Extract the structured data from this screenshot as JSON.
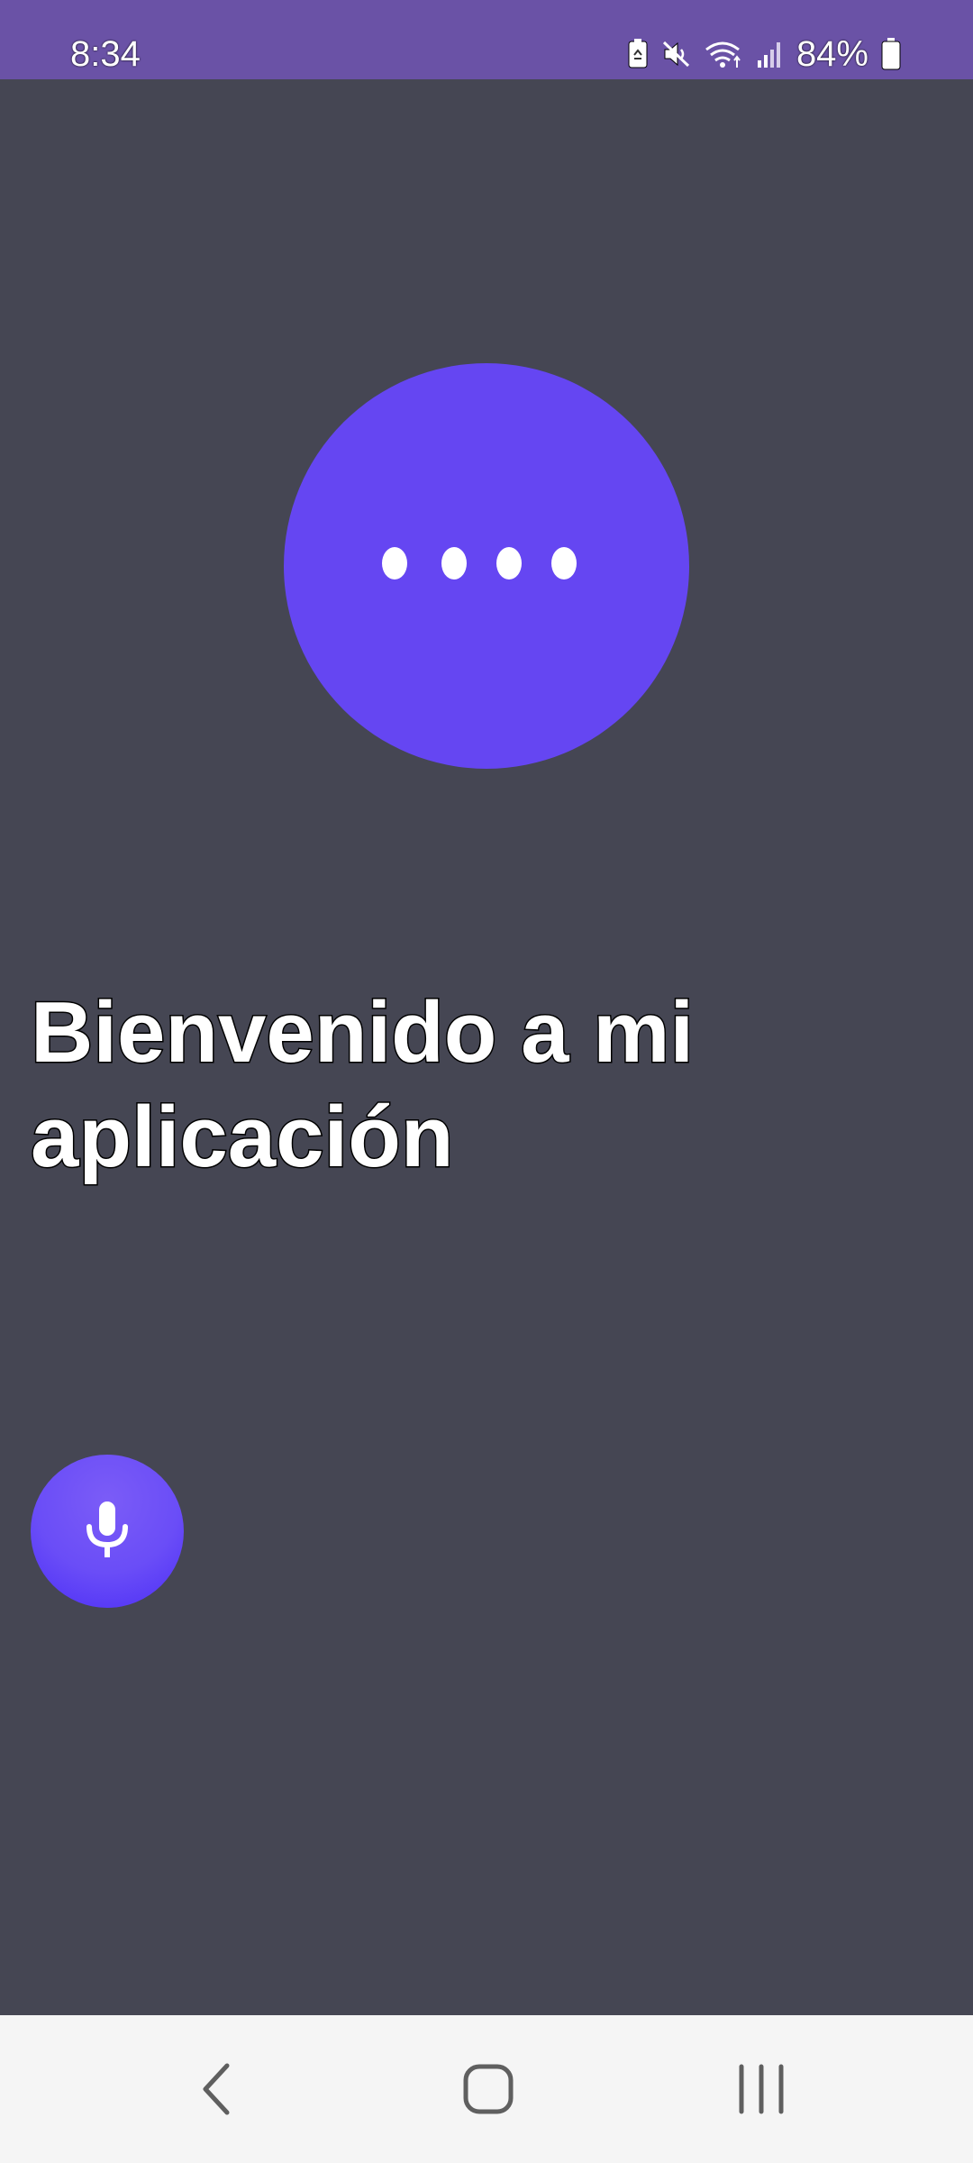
{
  "status_bar": {
    "time": "8:34",
    "battery_percent": "84%",
    "icons": [
      "battery-saver-icon",
      "mute-icon",
      "wifi-icon",
      "signal-icon",
      "battery-icon"
    ],
    "background_color": "#6a52a6"
  },
  "main": {
    "background_color": "#454653",
    "loader": {
      "dots": 4,
      "color": "#6546f2"
    },
    "welcome_title": "Bienvenido a mi aplicación",
    "mic_button": {
      "icon": "microphone-icon",
      "color": "#6a4df7"
    }
  },
  "nav_bar": {
    "buttons": [
      "back-icon",
      "home-icon",
      "recents-icon"
    ],
    "background_color": "#f5f5f5"
  }
}
